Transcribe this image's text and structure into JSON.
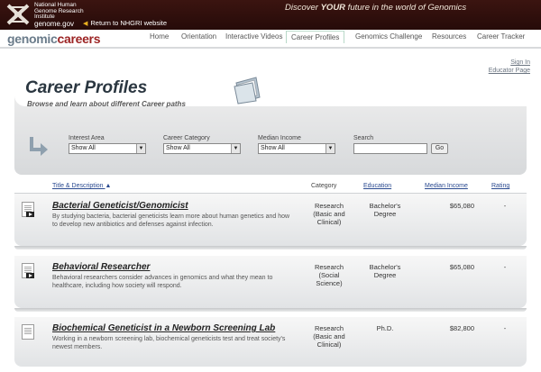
{
  "banner": {
    "institute_lines": [
      "National Human",
      "Genome Research",
      "Institute"
    ],
    "domain": "genome.gov",
    "return_link": "Return to NHGRI website",
    "tagline_before": "Discover ",
    "tagline_bold": "YOUR",
    "tagline_after": " future in the world of Genomics"
  },
  "brand": {
    "part1": "genomic",
    "part2": "careers"
  },
  "nav": [
    "Home",
    "Orientation",
    "Interactive Videos",
    "Career Profiles",
    "Genomics Challenge",
    "Resources",
    "Career Tracker"
  ],
  "nav_active": "Career Profiles",
  "account": {
    "sign_in": "Sign In",
    "educator": "Educator Page"
  },
  "header": {
    "title": "Career Profiles",
    "subtitle": "Browse and learn about different Career paths"
  },
  "filters": {
    "interest_label": "Interest Area",
    "interest_value": "Show All",
    "category_label": "Career Category",
    "category_value": "Show All",
    "income_label": "Median Income",
    "income_value": "Show All",
    "search_label": "Search",
    "search_value": "",
    "go_label": "Go"
  },
  "table_headers": {
    "title_desc": "Title & Description",
    "sort_arrow": "▲",
    "category": "Category",
    "education": "Education",
    "median_income": "Median Income",
    "rating": "Rating"
  },
  "rows": [
    {
      "title": "Bacterial Geneticist/Genomicist",
      "desc": "By studying bacteria, bacterial geneticists learn more about human genetics and how to develop new antibiotics and defenses against infection.",
      "category": [
        "Research",
        "(Basic and",
        "Clinical)"
      ],
      "education": [
        "Bachelor's",
        "Degree"
      ],
      "income": "$65,080",
      "rating": "-"
    },
    {
      "title": "Behavioral Researcher",
      "desc": "Behavioral researchers consider advances in genomics and what they mean to healthcare, including how society will respond.",
      "category": [
        "Research",
        "(Social",
        "Science)"
      ],
      "education": [
        "Bachelor's",
        "Degree"
      ],
      "income": "$65,080",
      "rating": "-"
    },
    {
      "title": "Biochemical Geneticist in a Newborn Screening Lab",
      "desc": "Working in a newborn screening lab, biochemical geneticists test and treat society's newest members.",
      "category": [
        "Research",
        "(Basic and",
        "Clinical)"
      ],
      "education": [
        "Ph.D."
      ],
      "income": "$82,800",
      "rating": "-"
    }
  ]
}
